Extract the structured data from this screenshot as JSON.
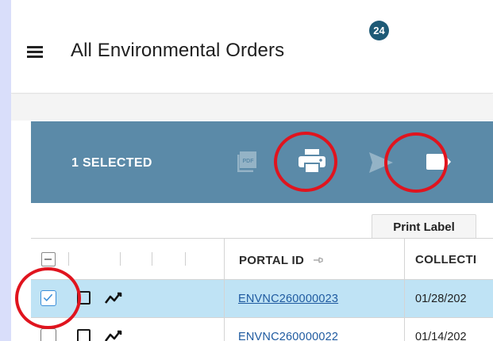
{
  "header": {
    "title": "All Environmental Orders",
    "count": "24",
    "menu_icon": "hamburger-menu-icon"
  },
  "toolbar": {
    "selected_label": "1 SELECTED",
    "actions": [
      {
        "name": "pdf",
        "icon": "pdf-icon",
        "enabled": false
      },
      {
        "name": "print",
        "icon": "printer-icon",
        "enabled": true,
        "highlighted": true
      },
      {
        "name": "send",
        "icon": "send-icon",
        "enabled": false
      },
      {
        "name": "label",
        "icon": "label-icon",
        "enabled": true,
        "highlighted": true
      }
    ],
    "tooltip": "Print Label",
    "background_color": "#5b8aa8",
    "highlight_color": "#e0141e"
  },
  "table": {
    "columns": [
      {
        "label": "PORTAL ID"
      },
      {
        "label": "COLLECTI"
      }
    ],
    "rows": [
      {
        "portal_id": "ENVNC260000023",
        "collection": "01/28/202",
        "checked": true
      },
      {
        "portal_id": "ENVNC260000022",
        "collection": "01/14/202",
        "checked": false
      }
    ],
    "selected_row_color": "#bfe3f5",
    "link_color": "#1e5aa0"
  }
}
